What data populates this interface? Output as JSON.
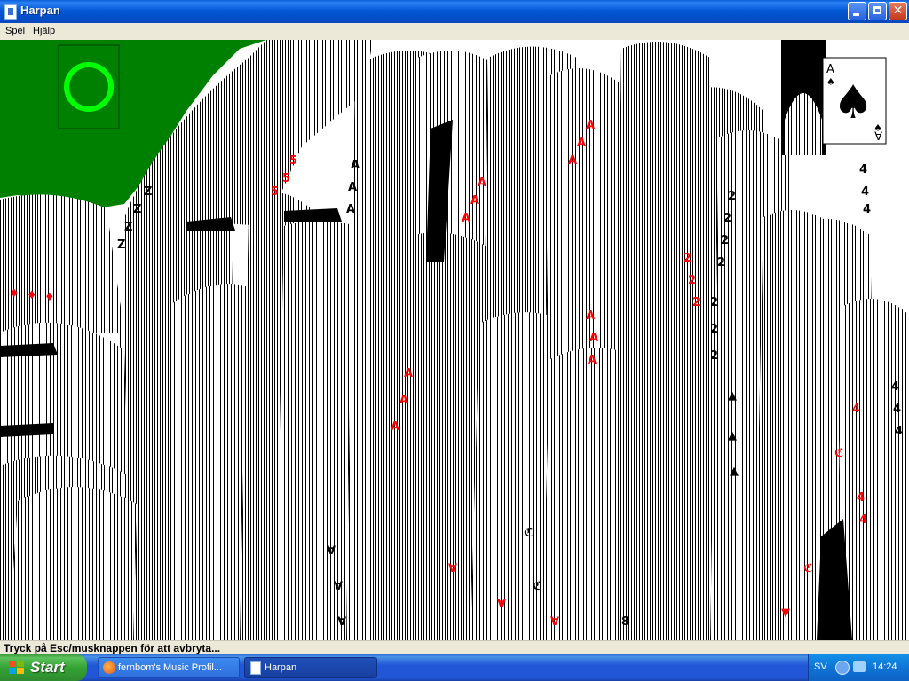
{
  "window": {
    "title": "Harpan"
  },
  "menubar": {
    "items": [
      "Spel",
      "Hjälp"
    ]
  },
  "status": {
    "text": "Tryck på Esc/musknappen för att avbryta..."
  },
  "cards": {
    "stock_marker": "O",
    "foundation_card_rank": "A"
  },
  "colors": {
    "felt": "#008000",
    "card_red": "#ff0000",
    "card_black": "#000000",
    "stock_ring": "#00ff00"
  },
  "taskbar": {
    "start_label": "Start",
    "tasks": [
      {
        "label": "fernbom's Music Profil...",
        "icon": "firefox-icon"
      },
      {
        "label": "Harpan",
        "icon": "solitaire-icon"
      }
    ],
    "tray": {
      "language": "SV",
      "time": "14:24"
    }
  }
}
